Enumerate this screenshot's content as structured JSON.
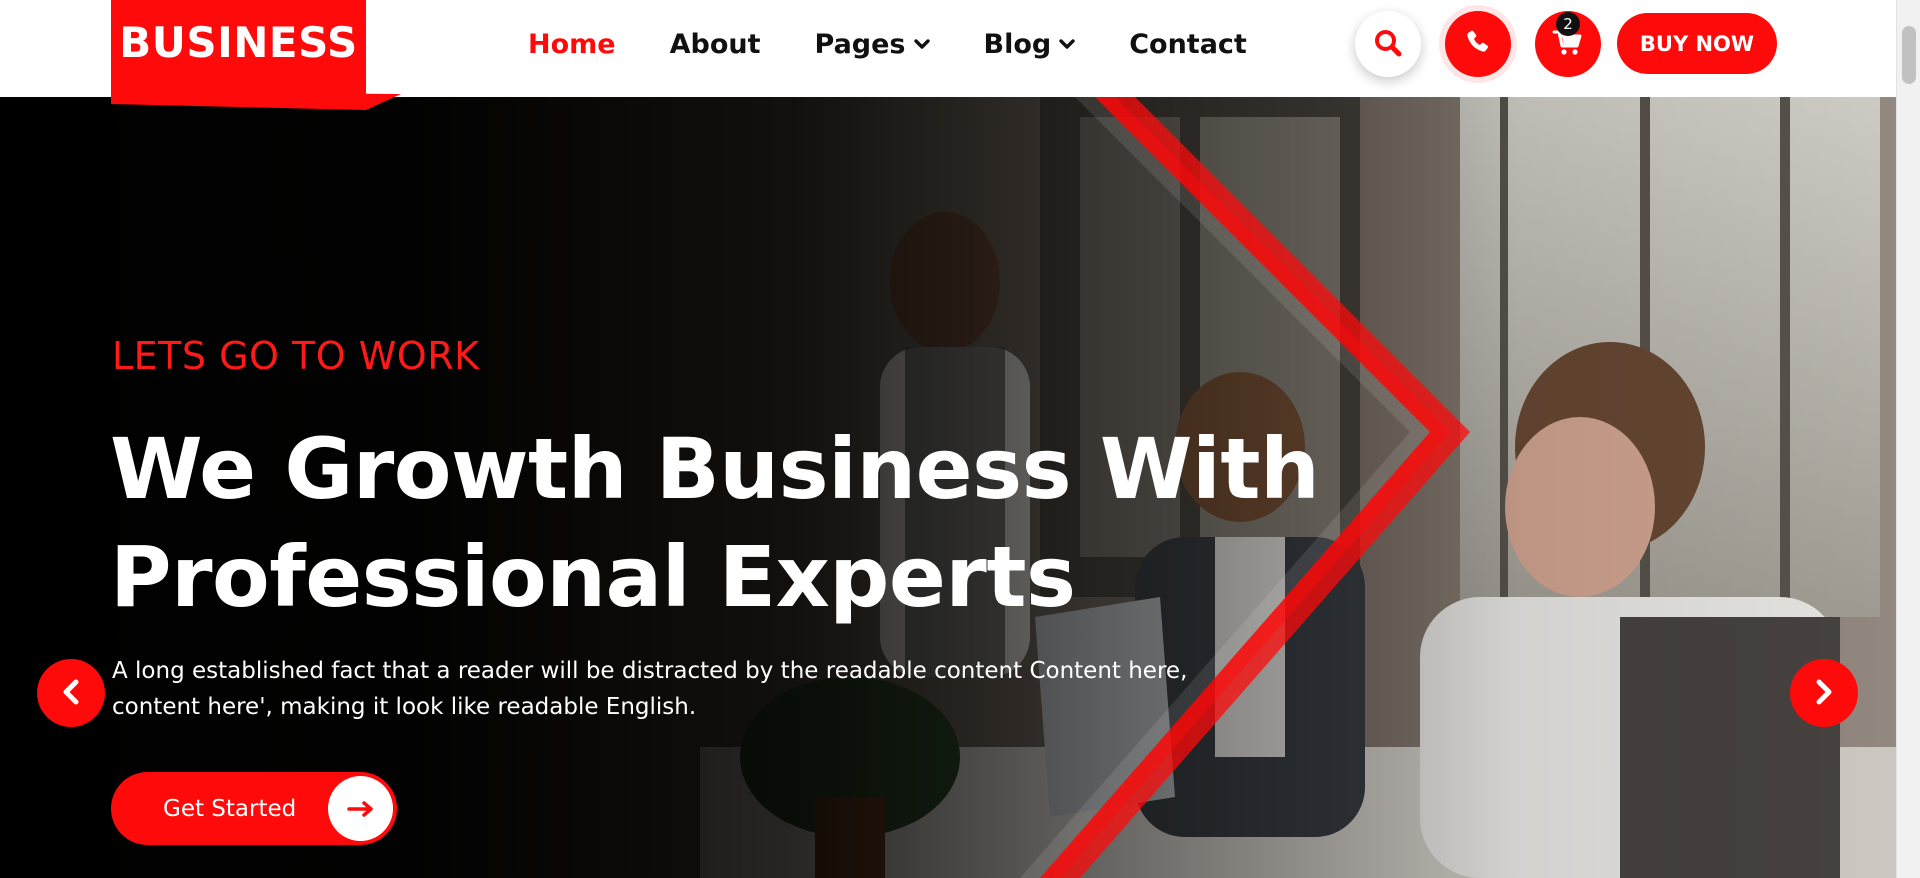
{
  "brand": {
    "name": "BUSINESS",
    "accent_color": "#ff0a0a"
  },
  "nav": {
    "items": [
      {
        "label": "Home",
        "active": true,
        "dropdown": false
      },
      {
        "label": "About",
        "active": false,
        "dropdown": false
      },
      {
        "label": "Pages",
        "active": false,
        "dropdown": true
      },
      {
        "label": "Blog",
        "active": false,
        "dropdown": true
      },
      {
        "label": "Contact",
        "active": false,
        "dropdown": false
      }
    ]
  },
  "header_actions": {
    "search_icon": "search-icon",
    "phone_icon": "phone-icon",
    "cart_icon": "cart-icon",
    "cart_count": "2",
    "buy_label": "BUY NOW"
  },
  "hero": {
    "eyebrow": "LETS GO TO WORK",
    "headline_line1": "We Growth Business With",
    "headline_line2": "Professional Experts",
    "description": "A long established fact that a reader will be distracted by the readable content Content here, content here', making it look like readable English.",
    "cta_label": "Get Started",
    "cta_icon": "arrow-right-icon",
    "prev_icon": "chevron-left-icon",
    "next_icon": "chevron-right-icon"
  }
}
